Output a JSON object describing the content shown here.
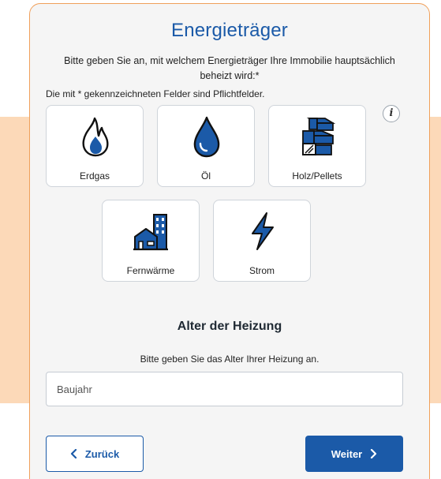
{
  "heading": "Energieträger",
  "instruction": "Bitte geben Sie an, mit welchem Energieträger Ihre Immobilie hauptsächlich beheizt wird:*",
  "required_note": "Die mit * gekennzeichneten Felder sind Pflichtfelder.",
  "info_label": "i",
  "options": [
    {
      "label": "Erdgas",
      "icon": "flame-icon"
    },
    {
      "label": "Öl",
      "icon": "oil-drop-icon"
    },
    {
      "label": "Holz/Pellets",
      "icon": "wood-logs-icon"
    },
    {
      "label": "Fernwärme",
      "icon": "district-heating-icon"
    },
    {
      "label": "Strom",
      "icon": "lightning-icon"
    }
  ],
  "age_section": {
    "title": "Alter der Heizung",
    "subtitle": "Bitte geben Sie das Alter Ihrer Heizung an.",
    "placeholder": "Baujahr",
    "value": ""
  },
  "nav": {
    "back_label": "Zurück",
    "next_label": "Weiter"
  },
  "colors": {
    "primary": "#1b5aa8",
    "accent_band": "#fcd9b8",
    "card_border": "#f0a05a",
    "icon_fill": "#1b5aa8"
  }
}
